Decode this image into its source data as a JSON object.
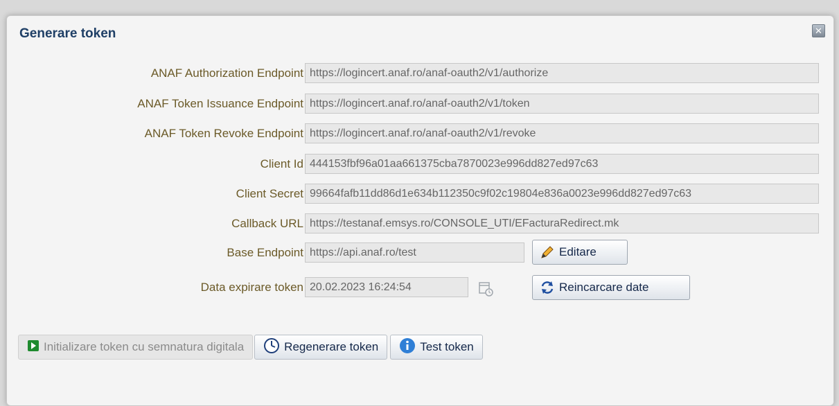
{
  "dialog": {
    "title": "Generare token",
    "close_icon": "close-x-icon"
  },
  "form": {
    "auth_label": "ANAF Authorization Endpoint",
    "auth_value": "https://logincert.anaf.ro/anaf-oauth2/v1/authorize",
    "token_label": "ANAF Token Issuance Endpoint",
    "token_value": "https://logincert.anaf.ro/anaf-oauth2/v1/token",
    "revoke_label": "ANAF Token Revoke Endpoint",
    "revoke_value": "https://logincert.anaf.ro/anaf-oauth2/v1/revoke",
    "client_id_label": "Client Id",
    "client_id_value": "444153fbf96a01aa661375cba7870023e996dd827ed97c63",
    "client_secret_label": "Client Secret",
    "client_secret_value": "99664fafb11dd86d1e634b112350c9f02c19804e836a0023e996dd827ed97c63",
    "callback_label": "Callback URL",
    "callback_value": "https://testanaf.emsys.ro/CONSOLE_UTI/EFacturaRedirect.mk",
    "base_label": "Base Endpoint",
    "base_value": "https://api.anaf.ro/test",
    "expiry_label": "Data expirare token",
    "expiry_value": "20.02.2023 16:24:54"
  },
  "buttons": {
    "edit": "Editare",
    "reload": "Reincarcare date",
    "init_token": "Initializare token cu semnatura digitala",
    "regen_token": "Regenerare token",
    "test_token": "Test token"
  },
  "colors": {
    "title": "#1f3f66",
    "label": "#6b5a28",
    "button_text": "#15284a",
    "field_bg": "#e8e8e8"
  }
}
